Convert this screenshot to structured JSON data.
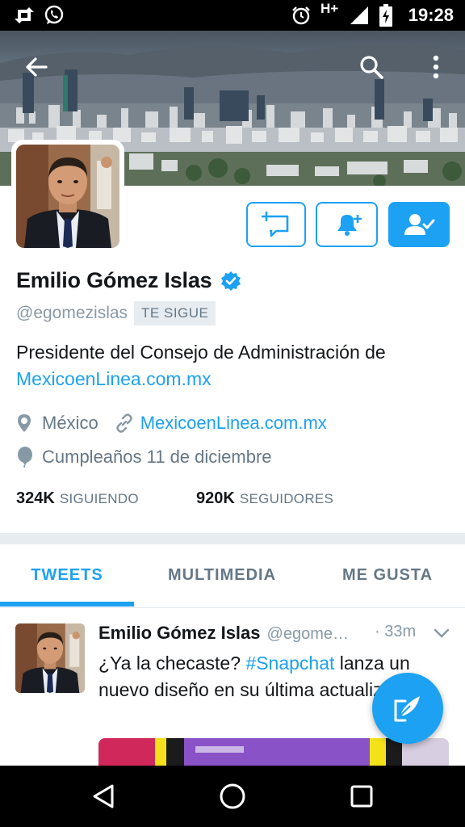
{
  "status_bar": {
    "time": "19:28",
    "network": "H+",
    "icons": [
      "retweet-icon",
      "whatsapp-icon",
      "alarm-icon",
      "signal-icon",
      "battery-charging-icon"
    ]
  },
  "header": {
    "back_icon": "arrow-left-icon",
    "search_icon": "search-icon",
    "more_icon": "more-vertical-icon"
  },
  "actions": {
    "message_icon": "direct-message-icon",
    "notify_icon": "bell-plus-icon",
    "following_icon": "user-check-icon"
  },
  "profile": {
    "name": "Emilio Gómez Islas",
    "handle": "@egomezislas",
    "follows_you": "TE SIGUE",
    "bio_text": "Presidente del Consejo de Administración de",
    "bio_link": "MexicoenLinea.com.mx",
    "location": "México",
    "website": "MexicoenLinea.com.mx",
    "birthday": "Cumpleaños 11 de diciembre",
    "following_count": "324K",
    "following_label": "SIGUIENDO",
    "followers_count": "920K",
    "followers_label": "SEGUIDORES"
  },
  "tabs": [
    {
      "label": "TWEETS",
      "active": true
    },
    {
      "label": "MULTIMEDIA",
      "active": false
    },
    {
      "label": "ME GUSTA",
      "active": false
    }
  ],
  "tweet": {
    "name": "Emilio Gómez Islas",
    "handle": "@egome…",
    "time": "· 33m",
    "text_before": "¿Ya la checaste? ",
    "hashtag": "#Snapchat",
    "text_after": " lanza un nuevo diseño en su última actualización"
  },
  "fab": {
    "icon": "compose-tweet-icon"
  },
  "nav_bar": {
    "icons": [
      "back-triangle-icon",
      "home-circle-icon",
      "recents-square-icon"
    ]
  },
  "colors": {
    "accent": "#1da1f2",
    "text": "#14171a",
    "muted": "#657786",
    "divider": "#e6ecf0"
  }
}
